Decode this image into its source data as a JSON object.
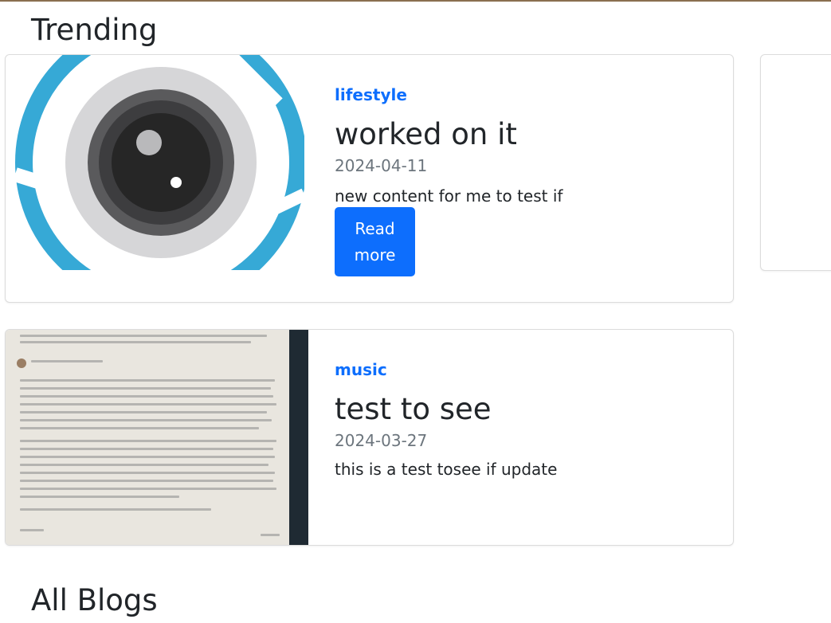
{
  "sections": {
    "trending_title": "Trending",
    "all_blogs_title": "All Blogs"
  },
  "posts": [
    {
      "category": "lifestyle",
      "title": "worked on it",
      "date": "2024-04-11",
      "excerpt": "new content for me to test if",
      "button_label": "Read more",
      "image_icon": "camera-lens-icon"
    },
    {
      "category": "music",
      "title": "test to see",
      "date": "2024-03-27",
      "excerpt": "this is a test tosee if update",
      "image_icon": "document-photo"
    }
  ],
  "colors": {
    "accent": "#0d6efd",
    "lens_ring": "#36a9d6",
    "muted_text": "#6c757d"
  }
}
